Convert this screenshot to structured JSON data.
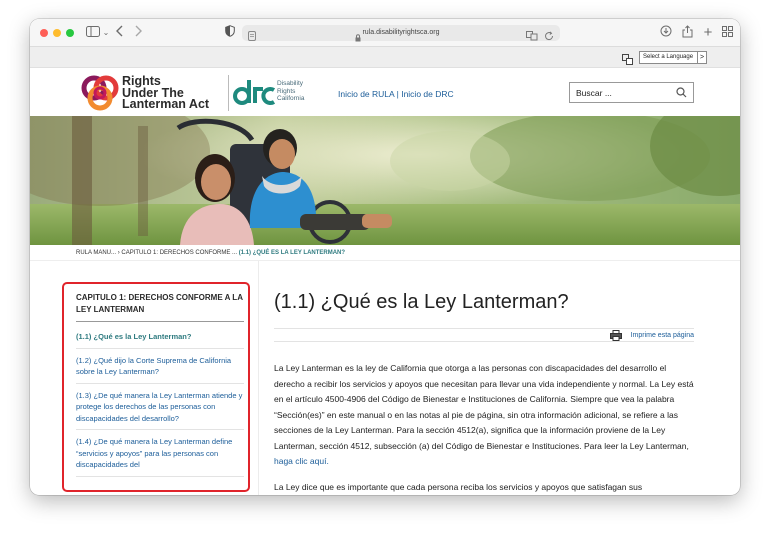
{
  "browser": {
    "url": "rula.disabilityrightsca.org"
  },
  "langbar": {
    "select_label": "Select a Language",
    "select_arrow": ">"
  },
  "header": {
    "logo_line1": "Rights",
    "logo_line2": "Under The",
    "logo_line3": "Lanterman Act",
    "drc_line1": "Disability",
    "drc_line2": "Rights",
    "drc_line3": "California",
    "nav_home_rula": "Inicio de RULA",
    "nav_separator": "|",
    "nav_home_drc": "Inicio de DRC",
    "search_placeholder": "Buscar ..."
  },
  "breadcrumb": {
    "item1": "RULA MANU...",
    "sep": "›",
    "item2": "CAPITULO 1: DERECHOS CONFORME ...",
    "current": "(1.1) ¿QUÉ ES LA LEY LANTERMAN?"
  },
  "sidebar": {
    "heading": "CAPITULO 1: DERECHOS CONFORME A LA LEY LANTERMAN",
    "items": [
      {
        "label": "(1.1) ¿Qué es la Ley Lanterman?"
      },
      {
        "label": "(1.2) ¿Qué dijo la Corte Suprema de California sobre la Ley Lanterman?"
      },
      {
        "label": "(1.3) ¿De qué manera la Ley Lanterman atiende y protege los derechos de las personas con discapacidades del desarrollo?"
      },
      {
        "label": "(1.4) ¿De qué manera la Ley Lanterman define “servicios y apoyos” para las personas con discapacidades del"
      }
    ]
  },
  "content": {
    "title": "(1.1) ¿Qué es la Ley Lanterman?",
    "print_label": "Imprime esta página",
    "paragraph1": "La Ley Lanterman es la ley de California que otorga a las personas con discapacidades del desarrollo el derecho a recibir los servicios y apoyos que necesitan para llevar una vida independiente y normal. La Ley está en el artículo 4500-4906 del Código de Bienestar e Instituciones de California. Siempre que vea la palabra “Sección(es)” en este manual o en las notas al pie de página, sin otra información adicional, se refiere a las secciones de la Ley Lanterman. Para la sección 4512(a), significa que la información proviene de la Ley Lanterman, sección 4512, subsección (a) del Código de Bienestar e Instituciones. Para leer la Ley Lanterman,",
    "paragraph1_link": "haga clic aquí.",
    "paragraph2": "La Ley dice que es importante que cada persona reciba los servicios y apoyos que satisfagan sus"
  },
  "colors": {
    "link": "#1c5d99",
    "active_link": "#2f7b80",
    "highlight_border": "#e0242b"
  }
}
